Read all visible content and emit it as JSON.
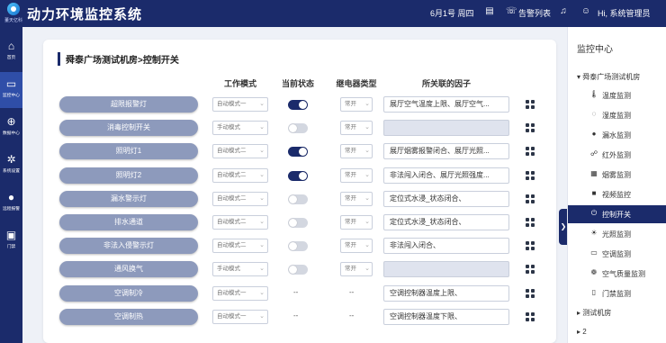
{
  "header": {
    "brand": "董天亿科",
    "title": "动力环境监控系统",
    "date": "6月1号 周四",
    "alarm_label": "告警列表",
    "greeting": "Hi, 系统管理员"
  },
  "leftnav": [
    {
      "label": "首页",
      "icon": "home-icon"
    },
    {
      "label": "监控中心",
      "icon": "monitor-icon"
    },
    {
      "label": "数据中心",
      "icon": "data-icon"
    },
    {
      "label": "系统设置",
      "icon": "gear-icon"
    },
    {
      "label": "远程报警",
      "icon": "bulb-icon"
    },
    {
      "label": "门禁",
      "icon": "door-icon"
    }
  ],
  "main": {
    "breadcrumb": "舜泰广场测试机房>控制开关",
    "columns": {
      "mode": "工作模式",
      "state": "当前状态",
      "relay": "继电器类型",
      "factor": "所关联的因子"
    },
    "rows": [
      {
        "name": "超限报警灯",
        "mode": "自动模式一",
        "state": "on",
        "relay": "常开",
        "factor": "展厅空气温度上限、展厅空气..."
      },
      {
        "name": "消毒控制开关",
        "mode": "手动模式",
        "state": "off",
        "relay": "常开",
        "factor": ""
      },
      {
        "name": "照明灯1",
        "mode": "自动模式二",
        "state": "on",
        "relay": "常开",
        "factor": "展厅烟雾报警闭合、展厅光照..."
      },
      {
        "name": "照明灯2",
        "mode": "自动模式二",
        "state": "on",
        "relay": "常开",
        "factor": "非法闯入闭合、展厅光照强度..."
      },
      {
        "name": "漏水警示灯",
        "mode": "自动模式二",
        "state": "off",
        "relay": "常开",
        "factor": "定位式水浸_状态闭合、"
      },
      {
        "name": "排水通道",
        "mode": "自动模式二",
        "state": "off",
        "relay": "常开",
        "factor": "定位式水浸_状态闭合、"
      },
      {
        "name": "非法入侵警示灯",
        "mode": "自动模式二",
        "state": "off",
        "relay": "常开",
        "factor": "非法闯入闭合、"
      },
      {
        "name": "通风换气",
        "mode": "手动模式",
        "state": "off",
        "relay": "常开",
        "factor": ""
      },
      {
        "name": "空调制冷",
        "mode": "自动模式一",
        "state": "--",
        "relay": "--",
        "factor": "空调控制器温度上限、"
      },
      {
        "name": "空调制热",
        "mode": "自动模式一",
        "state": "--",
        "relay": "--",
        "factor": "空调控制器温度下限、"
      }
    ]
  },
  "rpanel": {
    "title": "监控中心",
    "site": "舜泰广场测试机房",
    "items": [
      {
        "label": "温度监测",
        "icon": "thermometer-icon"
      },
      {
        "label": "湿度监测",
        "icon": "humidity-icon"
      },
      {
        "label": "漏水监测",
        "icon": "water-drop-icon"
      },
      {
        "label": "红外监测",
        "icon": "infrared-icon"
      },
      {
        "label": "烟雾监测",
        "icon": "smoke-icon"
      },
      {
        "label": "视频监控",
        "icon": "camera-icon"
      },
      {
        "label": "控制开关",
        "icon": "switch-icon"
      },
      {
        "label": "光照监测",
        "icon": "sun-icon"
      },
      {
        "label": "空调监测",
        "icon": "ac-icon"
      },
      {
        "label": "空气质量监测",
        "icon": "air-quality-icon"
      },
      {
        "label": "门禁监测",
        "icon": "door-icon"
      }
    ],
    "other_site": "测试机房",
    "other_node": "2"
  },
  "colors": {
    "navy": "#1b2b6b",
    "pill": "#8d9abc",
    "accent_active": "#2f4ea8"
  }
}
